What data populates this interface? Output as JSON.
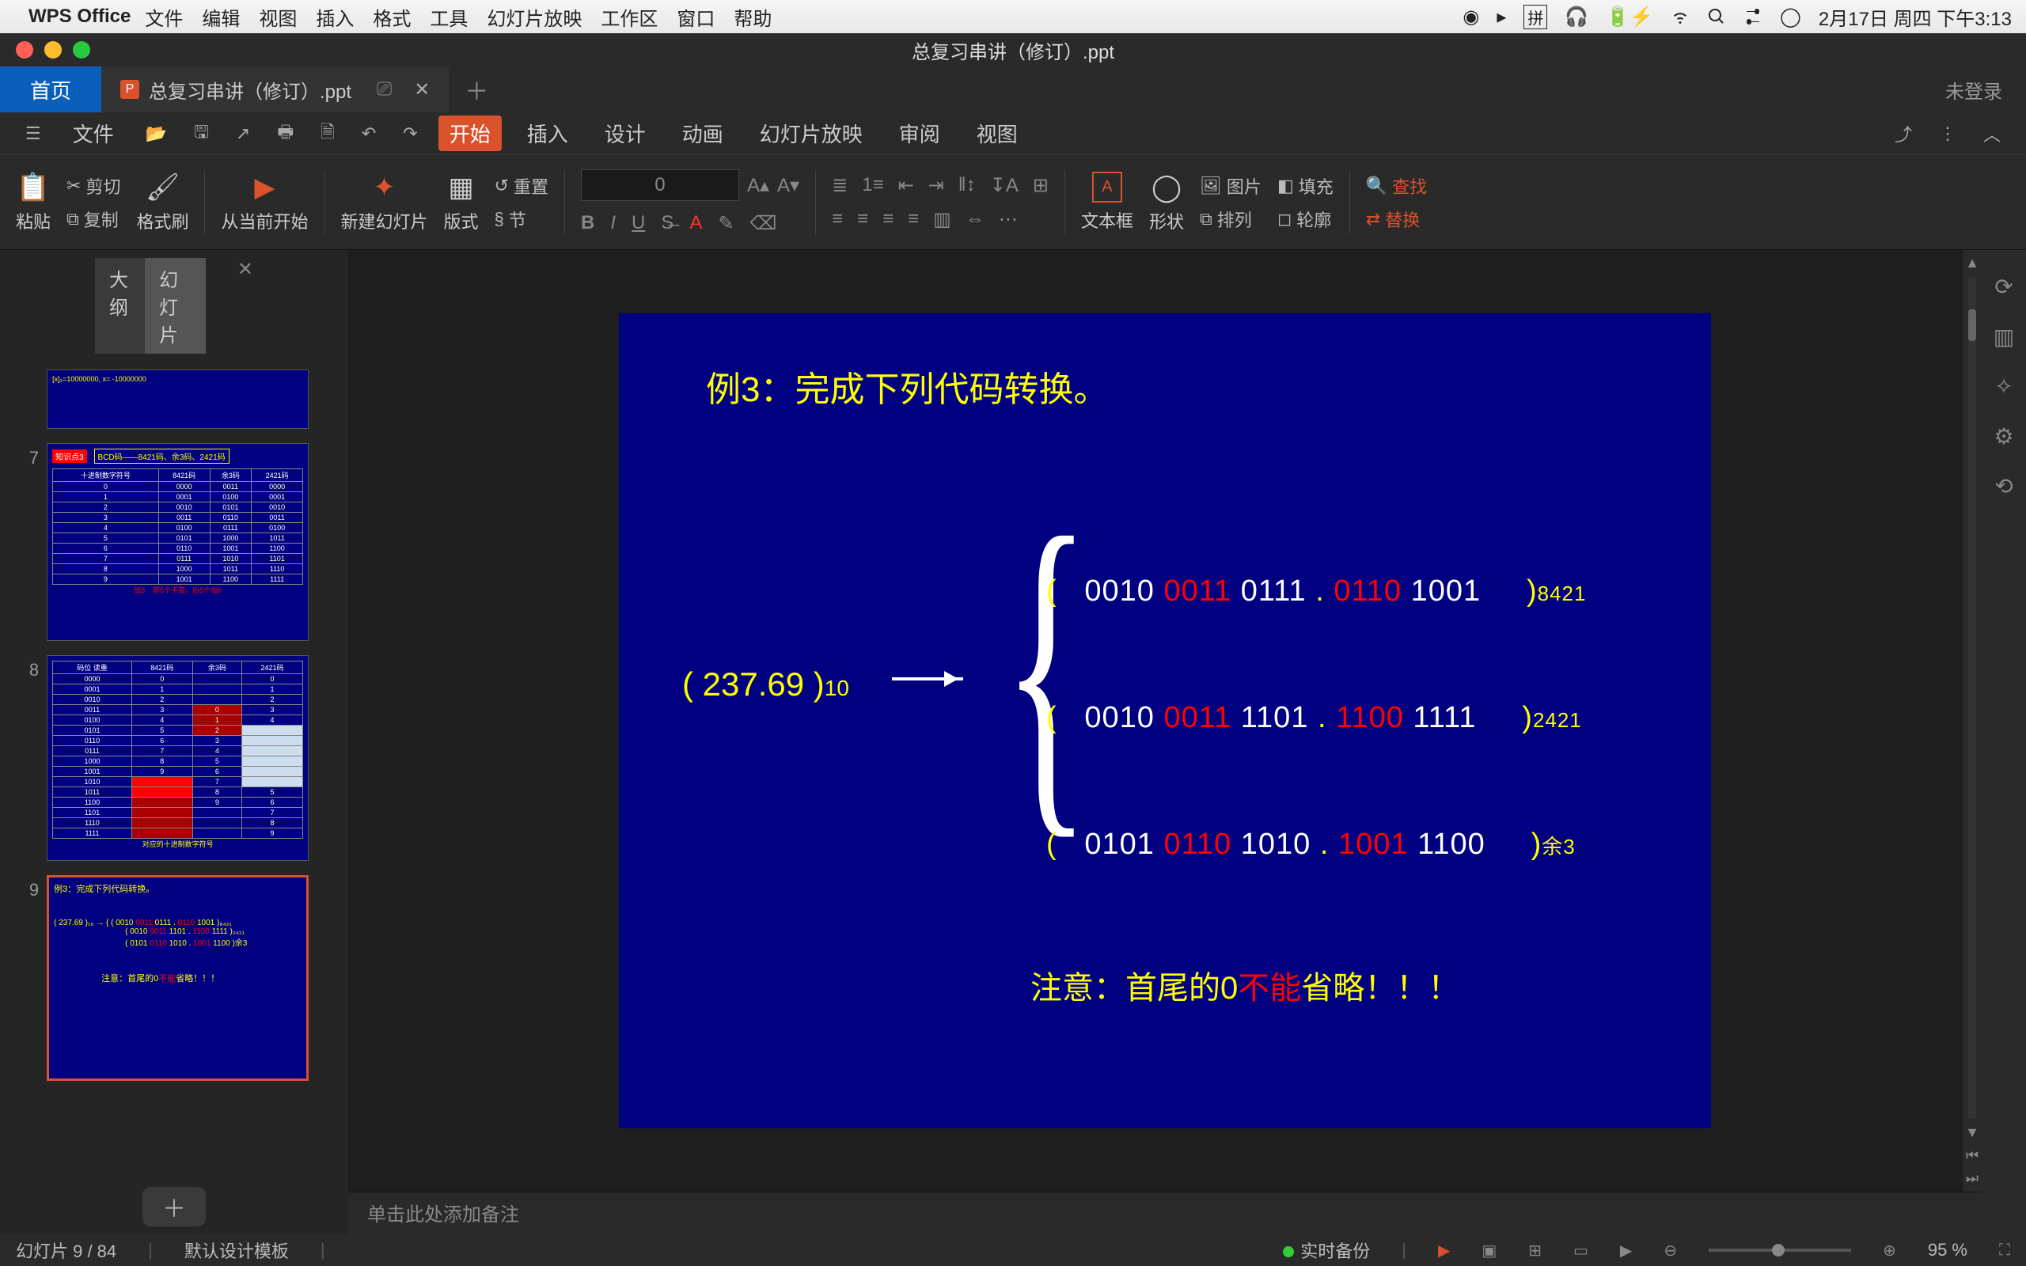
{
  "menubar": {
    "app": "WPS Office",
    "items": [
      "文件",
      "编辑",
      "视图",
      "插入",
      "格式",
      "工具",
      "幻灯片放映",
      "工作区",
      "窗口",
      "帮助"
    ],
    "right": {
      "ime": "拼",
      "date": "2月17日 周四 下午3:13"
    }
  },
  "window": {
    "title": "总复习串讲（修订）.ppt"
  },
  "tabs": {
    "home": "首页",
    "file": "总复习串讲（修订）.ppt",
    "login": "未登录"
  },
  "ribbon_menus": {
    "file": "文件",
    "items": [
      "开始",
      "插入",
      "设计",
      "动画",
      "幻灯片放映",
      "审阅",
      "视图"
    ],
    "active": "开始"
  },
  "ribbon": {
    "paste": "粘贴",
    "cut": "剪切",
    "copy": "复制",
    "format_painter": "格式刷",
    "from_current": "从当前开始",
    "new_slide": "新建幻灯片",
    "layout": "版式",
    "reset": "重置",
    "section": "节",
    "font_size": "0",
    "textbox": "文本框",
    "shape": "形状",
    "image": "图片",
    "arrange": "排列",
    "fill": "填充",
    "outline": "轮廓",
    "find": "查找",
    "replace": "替换"
  },
  "side": {
    "outline": "大纲",
    "slides": "幻灯片",
    "thumbs": [
      {
        "num": "",
        "h": "t75"
      },
      {
        "num": "7",
        "h": "big"
      },
      {
        "num": "8",
        "h": "big2"
      },
      {
        "num": "9",
        "h": "big3",
        "current": true
      }
    ]
  },
  "slide": {
    "title_a": "例3：",
    "title_b": "完成下列代码转换。",
    "lhs": "( 237.69 )",
    "lhs_sub": "10",
    "rows": [
      {
        "open": "(",
        "g1": "0010",
        "r1": "0011",
        "g2": "0111",
        "dot": ".",
        "r2": "0110",
        "g3": "1001",
        "close": ")",
        "suf": "8421"
      },
      {
        "open": "(",
        "g1": "0010",
        "r1": "0011",
        "g2": "1101",
        "dot": ".",
        "r2": "1100",
        "g3": "1111",
        "close": ")",
        "suf": "2421"
      },
      {
        "open": "(",
        "g1": "0101",
        "r1": "0110",
        "g2": "1010",
        "dot": ".",
        "r2": "1001",
        "g3": "1100",
        "close": ")",
        "suf": "余3"
      }
    ],
    "note_a": "注意：首尾的0",
    "note_r": "不能",
    "note_b": "省略！！！"
  },
  "notes_placeholder": "单击此处添加备注",
  "status": {
    "slide_pos": "幻灯片 9 / 84",
    "template": "默认设计模板",
    "backup": "实时备份",
    "zoom": "95 %"
  }
}
